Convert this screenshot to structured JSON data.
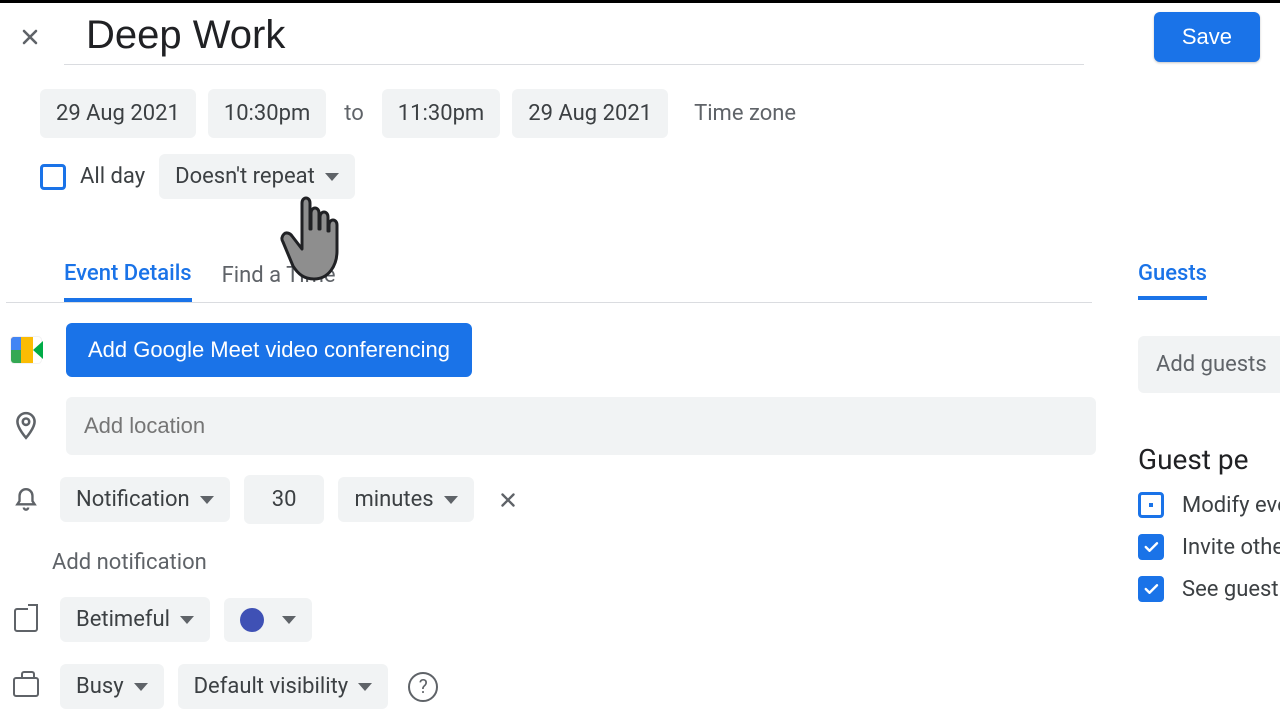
{
  "header": {
    "title": "Deep Work",
    "save_label": "Save"
  },
  "datetime": {
    "start_date": "29 Aug 2021",
    "start_time": "10:30pm",
    "to_label": "to",
    "end_time": "11:30pm",
    "end_date": "29 Aug 2021",
    "timezone_label": "Time zone"
  },
  "recurrence": {
    "all_day_label": "All day",
    "repeat_label": "Doesn't repeat"
  },
  "tabs": {
    "event_details": "Event Details",
    "find_a_time": "Find a Time"
  },
  "meet": {
    "button_label": "Add Google Meet video conferencing"
  },
  "location": {
    "placeholder": "Add location"
  },
  "notification": {
    "type_label": "Notification",
    "value": "30",
    "unit_label": "minutes",
    "add_label": "Add notification"
  },
  "calendar": {
    "name": "Betimeful",
    "color": "#3f51b5"
  },
  "availability": {
    "status": "Busy",
    "visibility": "Default visibility"
  },
  "guests": {
    "tab_label": "Guests",
    "add_placeholder": "Add guests",
    "permissions_title": "Guest pe",
    "modify_label": "Modify eve",
    "invite_label": "Invite others",
    "see_list_label": "See guest li"
  }
}
